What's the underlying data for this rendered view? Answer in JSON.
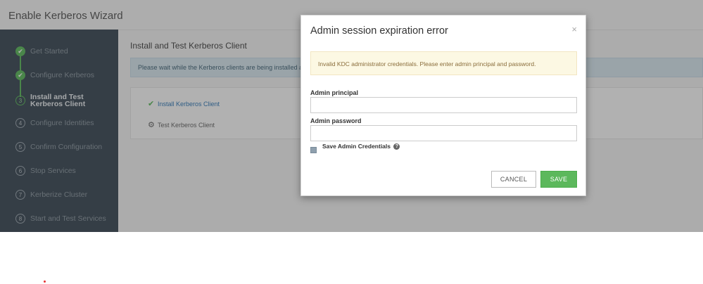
{
  "app": {
    "title": "Enable Kerberos Wizard"
  },
  "sidebar": {
    "steps": [
      {
        "label": "Get Started",
        "marker": "✔",
        "state": "done"
      },
      {
        "label": "Configure Kerberos",
        "marker": "✔",
        "state": "done"
      },
      {
        "label": "Install and Test Kerberos Client",
        "marker": "3",
        "state": "active"
      },
      {
        "label": "Configure Identities",
        "marker": "4",
        "state": "pending"
      },
      {
        "label": "Confirm Configuration",
        "marker": "5",
        "state": "pending"
      },
      {
        "label": "Stop Services",
        "marker": "6",
        "state": "pending"
      },
      {
        "label": "Kerberize Cluster",
        "marker": "7",
        "state": "pending"
      },
      {
        "label": "Start and Test Services",
        "marker": "8",
        "state": "pending"
      }
    ],
    "active_label_line1": "Install and Test",
    "active_label_line2": "Kerberos Client"
  },
  "content": {
    "title": "Install and Test Kerberos Client",
    "info": "Please wait while the Kerberos clients are being installed and te",
    "tasks": [
      {
        "label": "Install Kerberos Client",
        "icon": "check-icon",
        "color": "#337ab7"
      },
      {
        "label": "Test Kerberos Client",
        "icon": "gear-icon",
        "color": "#666666"
      }
    ]
  },
  "modal": {
    "title": "Admin session expiration error",
    "close": "×",
    "alert": "Invalid KDC administrator credentials. Please enter admin principal and password.",
    "principal_label": "Admin principal",
    "principal_value": "",
    "password_label": "Admin password",
    "password_value": "",
    "save_credentials_label": "Save Admin Credentials",
    "help_glyph": "?",
    "cancel_label": "CANCEL",
    "save_label": "SAVE"
  },
  "colors": {
    "success": "#5cb85c",
    "sidebar": "#3c4a56",
    "warning_bg": "#fcf8e3",
    "warning_text": "#8a6d3b"
  }
}
